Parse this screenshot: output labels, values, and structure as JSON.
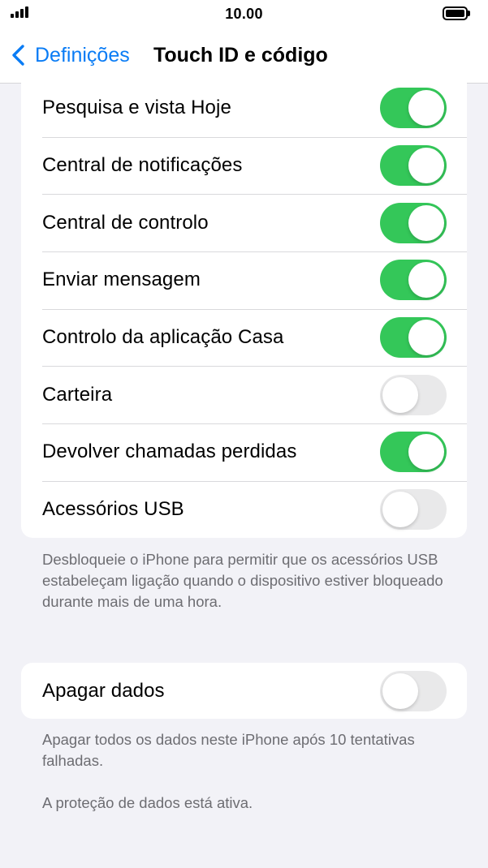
{
  "status_bar": {
    "time": "10.00"
  },
  "nav": {
    "back_label": "Definições",
    "title": "Touch ID e código"
  },
  "group_1": {
    "rows": [
      {
        "label": "Pesquisa e vista Hoje",
        "on": true
      },
      {
        "label": "Central de notificações",
        "on": true
      },
      {
        "label": "Central de controlo",
        "on": true
      },
      {
        "label": "Enviar mensagem",
        "on": true
      },
      {
        "label": "Controlo da aplicação Casa",
        "on": true
      },
      {
        "label": "Carteira",
        "on": false
      },
      {
        "label": "Devolver chamadas perdidas",
        "on": true
      },
      {
        "label": "Acessórios USB",
        "on": false
      }
    ],
    "footnote": "Desbloqueie o iPhone para permitir que os acessórios USB estabeleçam ligação quando o dispositivo estiver bloqueado durante mais de uma hora."
  },
  "group_2": {
    "row": {
      "label": "Apagar dados",
      "on": false
    },
    "footnote": "Apagar todos os dados neste iPhone após 10 tentativas falhadas.",
    "status": "A proteção de dados está ativa."
  },
  "colors": {
    "accent": "#0a7cf5",
    "toggle_on": "#34c759",
    "toggle_off": "#e9e9ea",
    "background": "#f2f2f7"
  },
  "icons": {
    "back": "chevron-left-icon",
    "signal": "cellular-signal-icon",
    "battery": "battery-icon"
  }
}
